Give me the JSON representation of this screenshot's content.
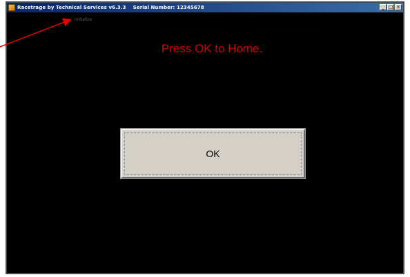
{
  "window": {
    "title": "Racetrage by Technical Services v6.3.3    Serial Number: 12345678",
    "minimize_label": "_",
    "maximize_label": "□",
    "close_label": "×"
  },
  "status": {
    "text": "Initialize"
  },
  "main": {
    "prompt": "Press OK to Home.",
    "ok_label": "OK"
  },
  "colors": {
    "background": "#000000",
    "prompt_red": "#d40000",
    "button_face": "#d4d0c8",
    "annotation_arrow": "#e00000"
  },
  "icons": {
    "app": "app-icon",
    "annotation": "red-arrow-icon"
  }
}
